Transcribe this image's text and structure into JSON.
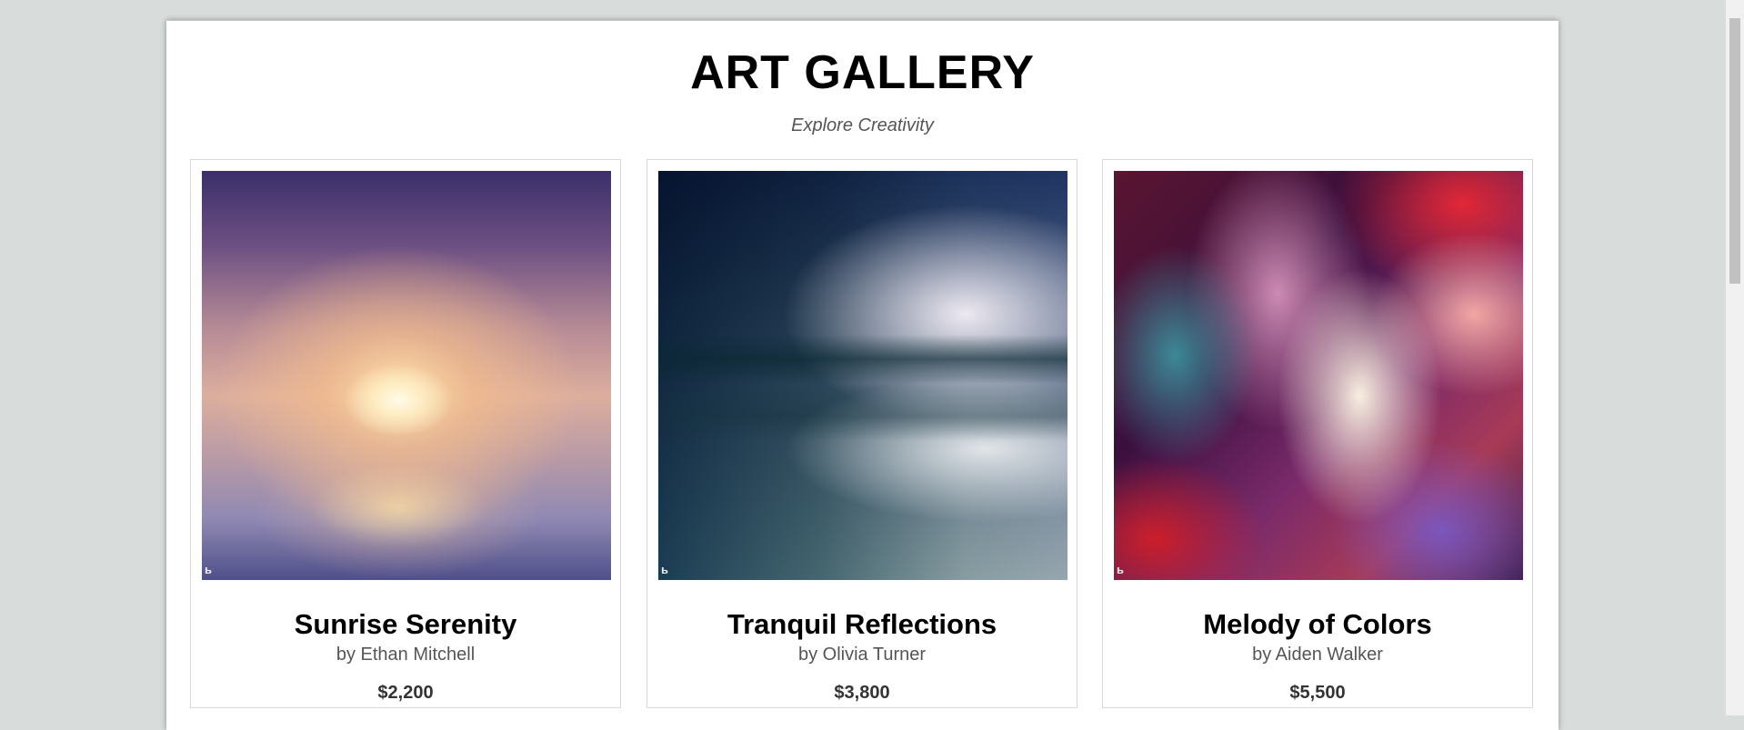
{
  "header": {
    "title": "ART GALLERY",
    "subtitle": "Explore Creativity"
  },
  "artworks": [
    {
      "title": "Sunrise Serenity",
      "artist": "by Ethan Mitchell",
      "price": "$2,200",
      "image_icon": "bing-logo-icon"
    },
    {
      "title": "Tranquil Reflections",
      "artist": "by Olivia Turner",
      "price": "$3,800",
      "image_icon": "bing-logo-icon"
    },
    {
      "title": "Melody of Colors",
      "artist": "by Aiden Walker",
      "price": "$5,500",
      "image_icon": "bing-logo-icon"
    }
  ],
  "colors": {
    "background": "#d8dcdb",
    "page": "#ffffff",
    "card_border": "#d9d9d9",
    "subtle_text": "#555555"
  }
}
